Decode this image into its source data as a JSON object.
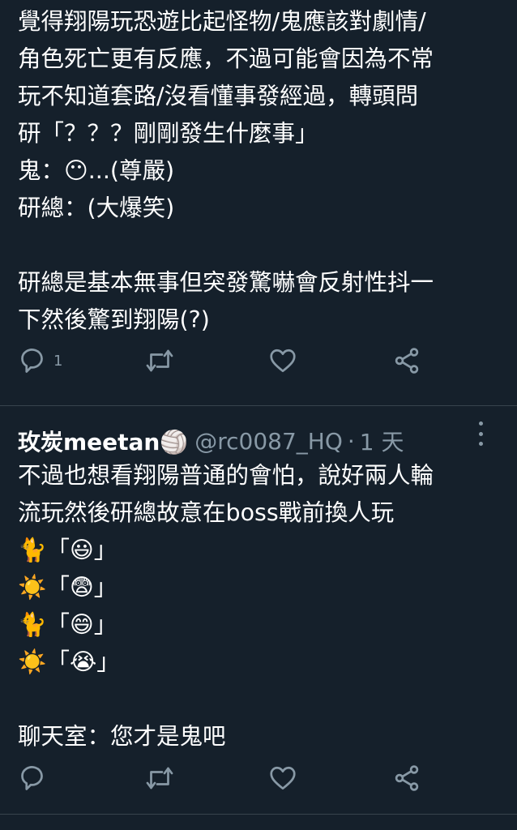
{
  "tweet1": {
    "lines": [
      "覺得翔陽玩恐遊比起怪物/鬼應該對劇情/",
      "角色死亡更有反應，不過可能會因為不常",
      "玩不知道套路/沒看懂事發經過，轉頭問",
      "研「？？？剛剛發生什麼事」",
      "鬼：😶...(尊嚴)",
      "研總：(大爆笑)",
      "",
      "研總是基本無事但突發驚嚇會反射性抖一",
      "下然後驚到翔陽(?)"
    ],
    "reply_count": "1"
  },
  "tweet2": {
    "display_name": "玫炭meetan🏐",
    "handle": "@rc0087_HQ",
    "separator": "·",
    "time": "1 天",
    "lines": [
      "不過也想看翔陽普通的會怕，說好兩人輪",
      "流玩然後研總故意在boss戰前換人玩",
      "🐈「😃」",
      "☀️「😨」",
      "🐈「😄」",
      "☀️「😭」",
      "",
      "聊天室：您才是鬼吧"
    ]
  },
  "icons": {
    "reply": "reply-icon",
    "retweet": "retweet-icon",
    "like": "heart-icon",
    "share": "share-icon",
    "more": "more-dots-icon"
  },
  "colors": {
    "background": "#15202b",
    "text": "#ffffff",
    "secondary": "#8899a6",
    "divider": "#38444d"
  }
}
